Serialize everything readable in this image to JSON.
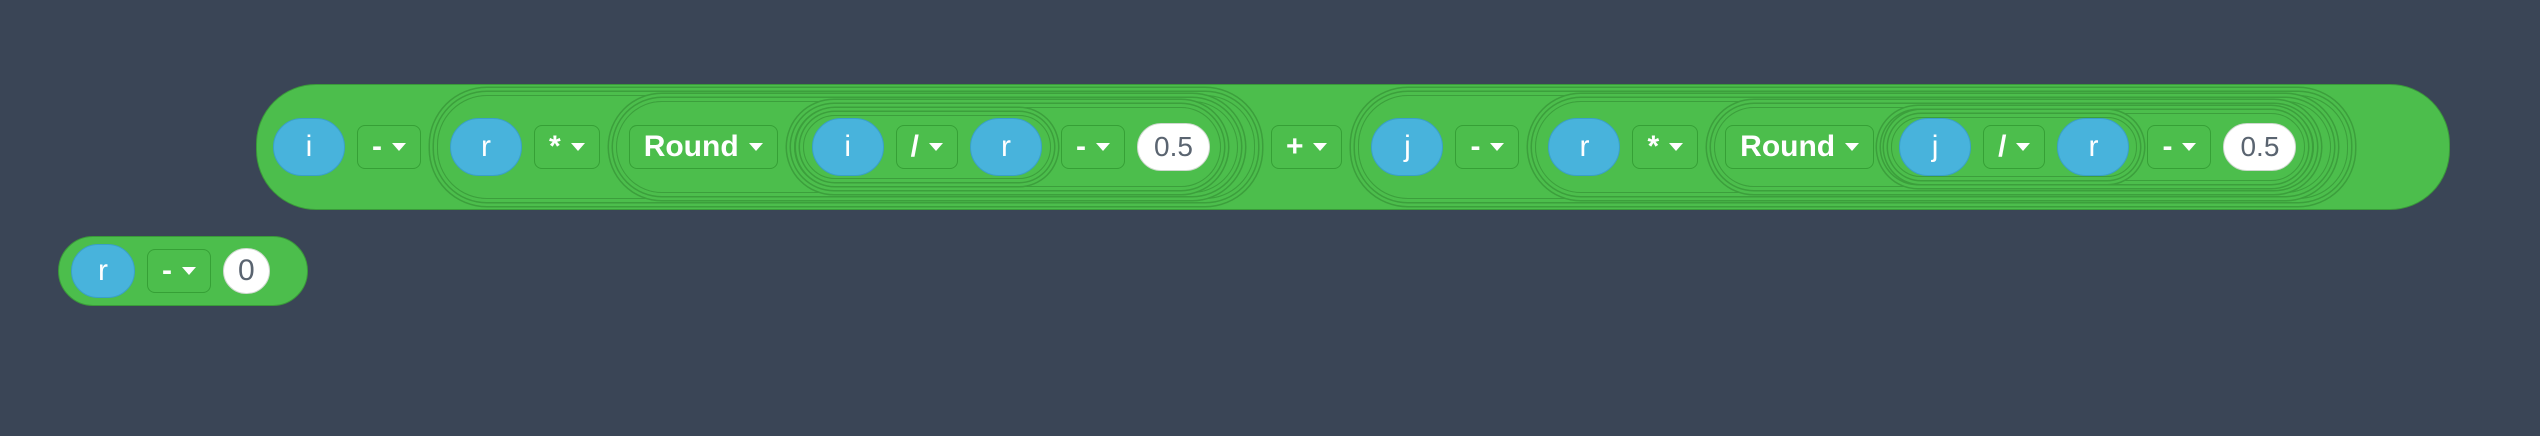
{
  "expr": {
    "ivar": "i",
    "iop": "-",
    "r1": "r",
    "r1op": "*",
    "round1": "Round",
    "i2": "i",
    "div1": "/",
    "r2": "r",
    "sub1": "-",
    "half1": "0.5",
    "plus": "+",
    "jvar": "j",
    "jop": "-",
    "r3": "r",
    "r3op": "*",
    "round2": "Round",
    "j2": "j",
    "div2": "/",
    "r4": "r",
    "sub2": "-",
    "half2": "0.5"
  },
  "small": {
    "var": "r",
    "op": "-",
    "value": "0"
  }
}
